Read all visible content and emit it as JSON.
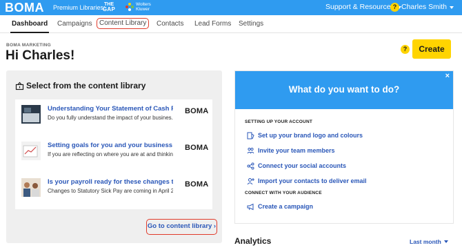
{
  "topbar": {
    "brand": "BOMA",
    "premium_label": "Premium Libraries:",
    "gap_logo": {
      "line1": "THE",
      "line2": "GAP"
    },
    "wk_logo": {
      "line1": "Wolters",
      "line2": "Kluwer"
    },
    "support_label": "Support & Resources",
    "help_icon_label": "?",
    "user_name": "Charles Smith"
  },
  "nav": {
    "tabs": [
      {
        "label": "Dashboard",
        "active": true
      },
      {
        "label": "Campaigns"
      },
      {
        "label": "Content Library",
        "circled": true
      },
      {
        "label": "Contacts"
      },
      {
        "label": "Lead Forms"
      },
      {
        "label": "Settings"
      }
    ]
  },
  "header": {
    "company": "BOMA MARKETING",
    "greeting": "Hi Charles!",
    "help_label": "?",
    "create_label": "Create"
  },
  "library": {
    "title": "Select from the content library",
    "items": [
      {
        "title": "Understanding Your Statement of Cash Fl...",
        "description": "Do you fully understand the impact of your busines...",
        "logo": "BOMA"
      },
      {
        "title": "Setting goals for you and your business fo...",
        "description": "If you are reflecting on where you are at and thinkin...",
        "logo": "BOMA"
      },
      {
        "title": "Is your payroll ready for these changes to ...",
        "description": "Changes to Statutory Sick Pay are coming in April 2...",
        "logo": "BOMA"
      }
    ],
    "link_label": "Go to content library ›"
  },
  "todo": {
    "close_label": "×",
    "title": "What do you want to do?",
    "section1": "SETTING UP YOUR ACCOUNT",
    "items1": [
      {
        "label": "Set up your brand logo and colours",
        "icon": "brand-icon"
      },
      {
        "label": "Invite your team members",
        "icon": "team-icon"
      },
      {
        "label": "Connect your social accounts",
        "icon": "share-icon"
      },
      {
        "label": "Import your contacts to deliver email",
        "icon": "add-contact-icon"
      }
    ],
    "section2": "CONNECT WITH YOUR AUDIENCE",
    "items2": [
      {
        "label": "Create a campaign",
        "icon": "megaphone-icon"
      }
    ]
  },
  "analytics": {
    "title": "Analytics",
    "period": "Last month"
  },
  "colors": {
    "accent": "#2f9bf0",
    "cta": "#ffd400",
    "link": "#2a57b8",
    "highlight": "#e03a2a"
  }
}
